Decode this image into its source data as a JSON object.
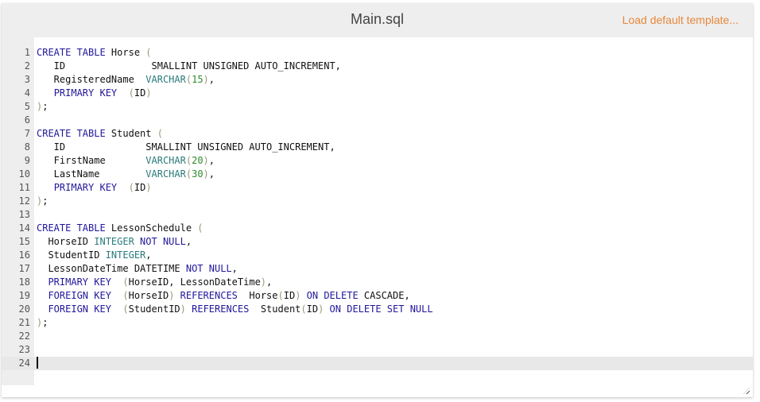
{
  "header": {
    "filename": "Main.sql",
    "load_template_label": "Load default template..."
  },
  "colors": {
    "keyword": "#22179b",
    "type": "#2b7a7a",
    "number": "#2e8b2e",
    "bracket": "#999977",
    "link": "#e8883a"
  },
  "editor": {
    "active_line": 24,
    "lines": [
      {
        "n": "1",
        "tokens": [
          [
            "kw",
            "CREATE TABLE"
          ],
          [
            "",
            "Horse "
          ],
          [
            "br",
            "("
          ]
        ]
      },
      {
        "n": "2",
        "tokens": [
          [
            "",
            "   ID               SMALLINT UNSIGNED AUTO_INCREMENT,"
          ]
        ]
      },
      {
        "n": "3",
        "tokens": [
          [
            "",
            "   RegisteredName  "
          ],
          [
            "ty",
            "VARCHAR"
          ],
          [
            "br",
            "("
          ],
          [
            "nm",
            "15"
          ],
          [
            "br",
            ")"
          ],
          [
            "",
            ","
          ]
        ]
      },
      {
        "n": "4",
        "tokens": [
          [
            "",
            "   "
          ],
          [
            "kw",
            "PRIMARY KEY"
          ],
          [
            "",
            "  "
          ],
          [
            "br",
            "("
          ],
          [
            "",
            "ID"
          ],
          [
            "br",
            ")"
          ]
        ]
      },
      {
        "n": "5",
        "tokens": [
          [
            "br",
            ")"
          ],
          [
            "",
            ";"
          ]
        ]
      },
      {
        "n": "6",
        "tokens": []
      },
      {
        "n": "7",
        "tokens": [
          [
            "kw",
            "CREATE TABLE"
          ],
          [
            "",
            "Student "
          ],
          [
            "br",
            "("
          ]
        ]
      },
      {
        "n": "8",
        "tokens": [
          [
            "",
            "   ID              SMALLINT UNSIGNED AUTO_INCREMENT,"
          ]
        ]
      },
      {
        "n": "9",
        "tokens": [
          [
            "",
            "   FirstName       "
          ],
          [
            "ty",
            "VARCHAR"
          ],
          [
            "br",
            "("
          ],
          [
            "nm",
            "20"
          ],
          [
            "br",
            ")"
          ],
          [
            "",
            ","
          ]
        ]
      },
      {
        "n": "10",
        "tokens": [
          [
            "",
            "   LastName        "
          ],
          [
            "ty",
            "VARCHAR"
          ],
          [
            "br",
            "("
          ],
          [
            "nm",
            "30"
          ],
          [
            "br",
            ")"
          ],
          [
            "",
            ","
          ]
        ]
      },
      {
        "n": "11",
        "tokens": [
          [
            "",
            "   "
          ],
          [
            "kw",
            "PRIMARY KEY"
          ],
          [
            "",
            "  "
          ],
          [
            "br",
            "("
          ],
          [
            "",
            "ID"
          ],
          [
            "br",
            ")"
          ]
        ]
      },
      {
        "n": "12",
        "tokens": [
          [
            "br",
            ")"
          ],
          [
            "",
            ";"
          ]
        ]
      },
      {
        "n": "13",
        "tokens": []
      },
      {
        "n": "14",
        "tokens": [
          [
            "kw",
            "CREATE TABLE"
          ],
          [
            "",
            "LessonSchedule "
          ],
          [
            "br",
            "("
          ]
        ]
      },
      {
        "n": "15",
        "tokens": [
          [
            "",
            "  HorseID "
          ],
          [
            "ty",
            "INTEGER"
          ],
          [
            "",
            ""
          ],
          [
            "kw",
            " NOT NULL"
          ],
          [
            "",
            ","
          ]
        ]
      },
      {
        "n": "16",
        "tokens": [
          [
            "",
            "  StudentID "
          ],
          [
            "ty",
            "INTEGER"
          ],
          [
            "",
            ","
          ]
        ]
      },
      {
        "n": "17",
        "tokens": [
          [
            "",
            "  LessonDateTime DATETIME"
          ],
          [
            "kw",
            " NOT NULL"
          ],
          [
            "",
            ","
          ]
        ]
      },
      {
        "n": "18",
        "tokens": [
          [
            "",
            "  "
          ],
          [
            "kw",
            "PRIMARY KEY"
          ],
          [
            "",
            "  "
          ],
          [
            "br",
            "("
          ],
          [
            "",
            "HorseID, LessonDateTime"
          ],
          [
            "br",
            ")"
          ],
          [
            "",
            ","
          ]
        ]
      },
      {
        "n": "19",
        "tokens": [
          [
            "",
            "  "
          ],
          [
            "kw",
            "FOREIGN KEY"
          ],
          [
            "",
            "  "
          ],
          [
            "br",
            "("
          ],
          [
            "",
            "HorseID"
          ],
          [
            "br",
            ")"
          ],
          [
            "kw",
            " REFERENCES"
          ],
          [
            "",
            ""
          ],
          [
            "",
            ""
          ],
          [
            "",
            "  Horse"
          ],
          [
            "br",
            "("
          ],
          [
            "",
            "ID"
          ],
          [
            "br",
            ")"
          ],
          [
            "kw",
            " ON DELETE"
          ],
          [
            "",
            " CASCADE,"
          ]
        ]
      },
      {
        "n": "20",
        "tokens": [
          [
            "",
            "  "
          ],
          [
            "kw",
            "FOREIGN KEY"
          ],
          [
            "",
            "  "
          ],
          [
            "br",
            "("
          ],
          [
            "",
            "StudentID"
          ],
          [
            "br",
            ")"
          ],
          [
            "kw",
            " REFERENCES"
          ],
          [
            "",
            "  Student"
          ],
          [
            "br",
            "("
          ],
          [
            "",
            "ID"
          ],
          [
            "br",
            ")"
          ],
          [
            "kw",
            " ON DELETE SET NULL"
          ]
        ]
      },
      {
        "n": "21",
        "tokens": [
          [
            "br",
            ")"
          ],
          [
            "",
            ";"
          ]
        ]
      },
      {
        "n": "22",
        "tokens": []
      },
      {
        "n": "23",
        "tokens": []
      },
      {
        "n": "24",
        "tokens": []
      }
    ]
  }
}
